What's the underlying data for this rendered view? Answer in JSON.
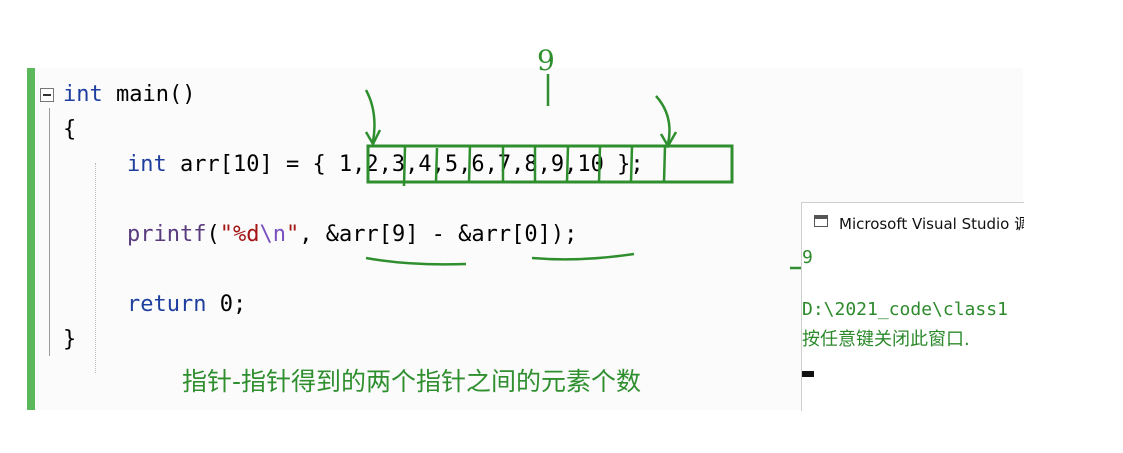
{
  "code": {
    "line1": {
      "kw": "int",
      "rest": " main()"
    },
    "line2": "{",
    "line3": {
      "kw": "int",
      "rest": " arr[10] = { 1,2,3,4,5,6,7,8,9,10 };"
    },
    "line4": {
      "fn": "printf",
      "open": "(",
      "str1": "\"%d",
      "esc": "\\n",
      "str2": "\"",
      "rest": ", &arr[9] - &arr[0]);"
    },
    "line5": {
      "kw": "return",
      "rest": " 0;"
    },
    "line6": "}"
  },
  "annotation": {
    "caption": "指针-指针得到的两个指针之间的元素个数",
    "handwritten_number": "9"
  },
  "console": {
    "title": "Microsoft Visual Studio 调",
    "output_line1": "9",
    "output_line2": "D:\\2021_code\\class1",
    "output_line3": "按任意键关闭此窗口. "
  },
  "colors": {
    "keyword": "#1f3f9f",
    "annotation_green": "#2f8f2f",
    "gutter_green": "#5cb85c"
  }
}
